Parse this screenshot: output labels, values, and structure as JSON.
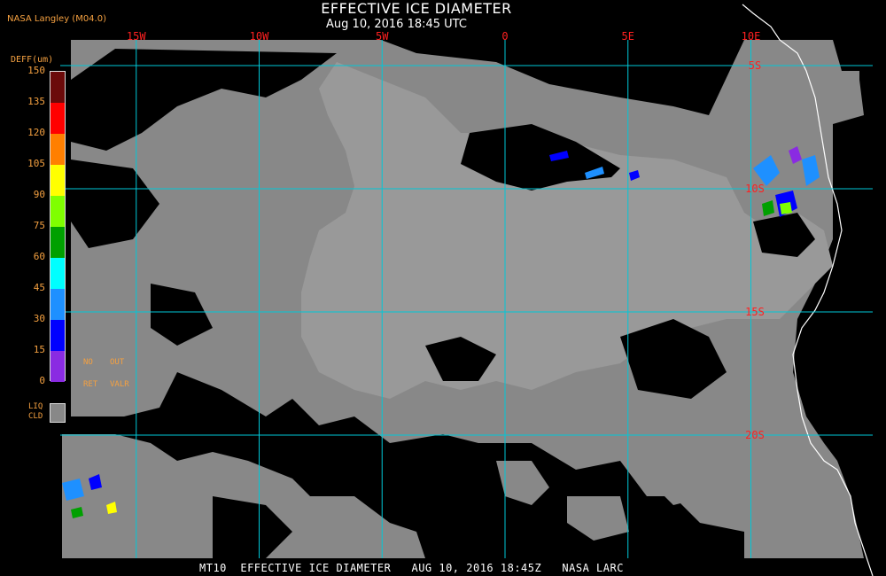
{
  "header": {
    "title": "EFFECTIVE ICE DIAMETER",
    "subtitle": "Aug 10, 2016 18:45 UTC",
    "source": "NASA Langley (M04.0)"
  },
  "footer": {
    "text": "MT10  EFFECTIVE ICE DIAMETER   AUG 10, 2016 18:45Z   NASA LARC"
  },
  "legend": {
    "title": "DEFF(um)",
    "ticks": [
      "150",
      "135",
      "120",
      "105",
      "90",
      "75",
      "60",
      "45",
      "30",
      "15",
      "0"
    ],
    "colors": [
      "#6b0a0a",
      "#ff0000",
      "#ff7f00",
      "#ffff00",
      "#7fff00",
      "#00a000",
      "#00ffff",
      "#1e90ff",
      "#0000ff",
      "#8a2be2"
    ],
    "no_ret_label_1": "NO",
    "no_ret_label_2": "RET",
    "out_valr_label_1": "OUT",
    "out_valr_label_2": "VALR",
    "liq_label_1": "LIQ",
    "liq_label_2": "CLD"
  },
  "map": {
    "lon_labels": [
      {
        "label": "15W",
        "lon": -15
      },
      {
        "label": "10W",
        "lon": -10
      },
      {
        "label": "5W",
        "lon": -5
      },
      {
        "label": "0",
        "lon": 0
      },
      {
        "label": "5E",
        "lon": 5
      },
      {
        "label": "10E",
        "lon": 10
      }
    ],
    "lat_labels": [
      {
        "label": "5S",
        "lat": -5
      },
      {
        "label": "10S",
        "lat": -10
      },
      {
        "label": "15S",
        "lat": -15
      },
      {
        "label": "20S",
        "lat": -20
      }
    ],
    "grid_color": "#00c8d8",
    "label_color": "#ff2020",
    "liquid_cloud_color": "#888888"
  }
}
